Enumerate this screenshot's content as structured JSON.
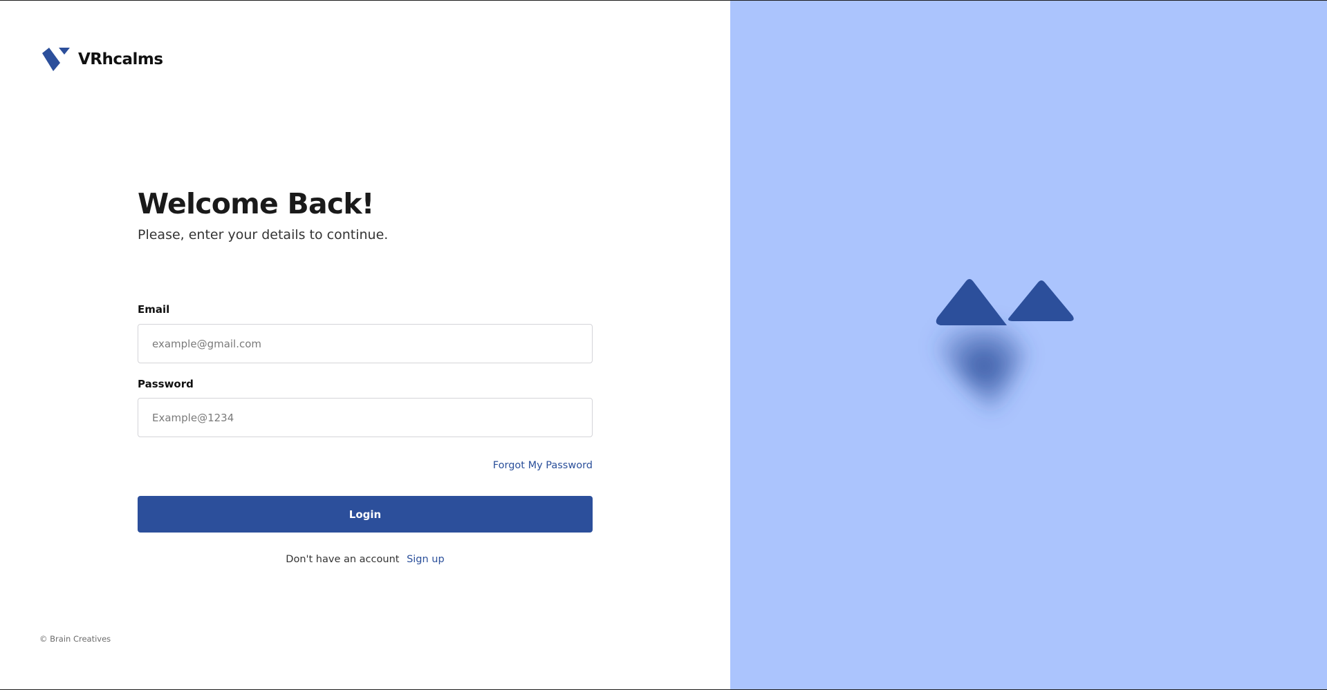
{
  "brand": {
    "name": "VRhcalms",
    "logo_icon": "vrh-logo-icon",
    "color": "#2c4f9b"
  },
  "login": {
    "heading": "Welcome Back!",
    "subheading": "Please, enter your details to continue.",
    "email": {
      "label": "Email",
      "placeholder": "example@gmail.com",
      "value": ""
    },
    "password": {
      "label": "Password",
      "placeholder": "Example@1234",
      "value": ""
    },
    "forgot_label": "Forgot My Password",
    "submit_label": "Login",
    "signup_prompt": "Don't have an account",
    "signup_label": "Sign up"
  },
  "footer": {
    "copyright": "© Brain Creatives"
  },
  "hero": {
    "illustration_icon": "mountains-illustration-icon",
    "background_color": "#abc4fd",
    "shape_color": "#2c4f9b"
  }
}
